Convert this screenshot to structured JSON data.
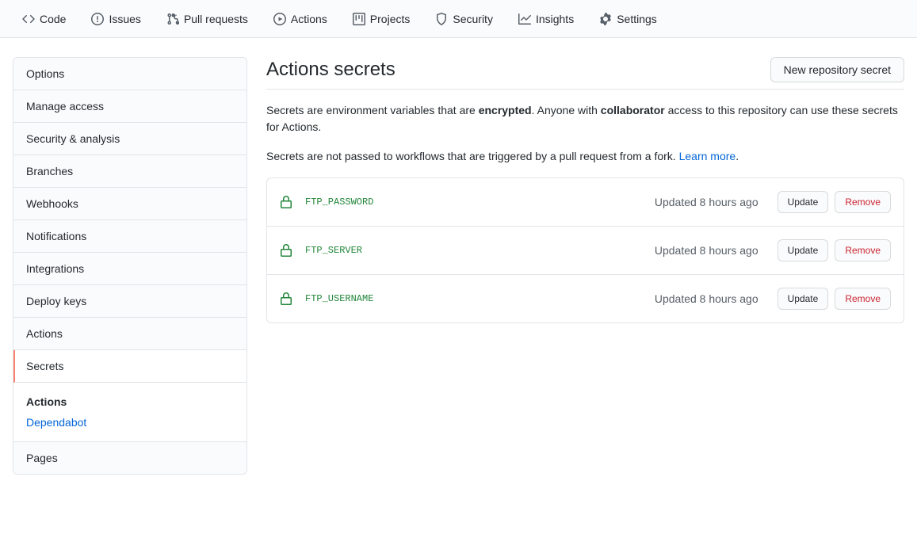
{
  "topnav": [
    {
      "label": "Code",
      "icon": "code"
    },
    {
      "label": "Issues",
      "icon": "issue"
    },
    {
      "label": "Pull requests",
      "icon": "pr"
    },
    {
      "label": "Actions",
      "icon": "play"
    },
    {
      "label": "Projects",
      "icon": "project"
    },
    {
      "label": "Security",
      "icon": "shield"
    },
    {
      "label": "Insights",
      "icon": "graph"
    },
    {
      "label": "Settings",
      "icon": "gear"
    }
  ],
  "sidebar": {
    "items": [
      {
        "label": "Options"
      },
      {
        "label": "Manage access"
      },
      {
        "label": "Security & analysis"
      },
      {
        "label": "Branches"
      },
      {
        "label": "Webhooks"
      },
      {
        "label": "Notifications"
      },
      {
        "label": "Integrations"
      },
      {
        "label": "Deploy keys"
      },
      {
        "label": "Actions"
      },
      {
        "label": "Secrets",
        "selected": true
      }
    ],
    "subgroup": {
      "head": "Actions",
      "link": "Dependabot"
    },
    "trailing": [
      {
        "label": "Pages"
      }
    ]
  },
  "page": {
    "title": "Actions secrets",
    "new_button": "New repository secret",
    "desc1_a": "Secrets are environment variables that are ",
    "desc1_b": "encrypted",
    "desc1_c": ". Anyone with ",
    "desc1_d": "collaborator",
    "desc1_e": " access to this repository can use these secrets for Actions.",
    "desc2_a": "Secrets are not passed to workflows that are triggered by a pull request from a fork. ",
    "desc2_link": "Learn more",
    "desc2_b": "."
  },
  "secrets": [
    {
      "name": "FTP_PASSWORD",
      "updated": "Updated 8 hours ago"
    },
    {
      "name": "FTP_SERVER",
      "updated": "Updated 8 hours ago"
    },
    {
      "name": "FTP_USERNAME",
      "updated": "Updated 8 hours ago"
    }
  ],
  "buttons": {
    "update": "Update",
    "remove": "Remove"
  }
}
